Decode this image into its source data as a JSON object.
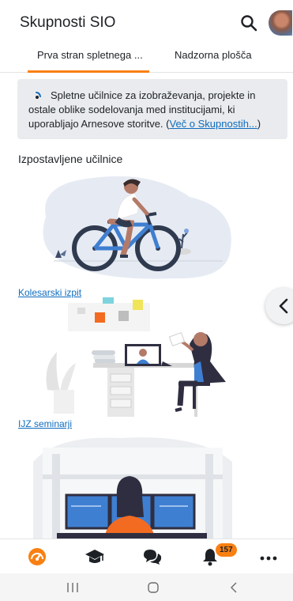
{
  "app": {
    "title": "Skupnosti SIO"
  },
  "header": {
    "search_icon": "search-icon",
    "avatar_icon": "user-avatar"
  },
  "tabs": [
    {
      "label": "Prva stran spletnega ...",
      "active": true
    },
    {
      "label": "Nadzorna plošča",
      "active": false
    }
  ],
  "notice": {
    "text": "Spletne učilnice za izobraževanja, projekte in ostale oblike sodelovanja med institucijami, ki uporabljajo Arnesove storitve. (",
    "link": "Več o Skupnostih...",
    "suffix": ")"
  },
  "featured": {
    "title": "Izpostavljene učilnice",
    "courses": [
      {
        "name": "Kolesarski izpit",
        "image": "cyclist-illustration"
      },
      {
        "name": "IJZ seminarji",
        "image": "online-meeting-illustration"
      },
      {
        "name": "",
        "image": "monitors-illustration"
      }
    ]
  },
  "side_toggle": {
    "icon": "chevron-left-icon"
  },
  "bottom_nav": {
    "items": [
      "dashboard-icon",
      "courses-icon",
      "messages-icon",
      "notifications-icon",
      "more-icon"
    ],
    "notification_count": "157"
  },
  "system_nav": [
    "recent-apps-icon",
    "home-icon",
    "back-icon"
  ],
  "colors": {
    "accent": "#f98012",
    "link": "#0f6cbf",
    "notice_bg": "#e9ebee",
    "text": "#1d2125"
  }
}
